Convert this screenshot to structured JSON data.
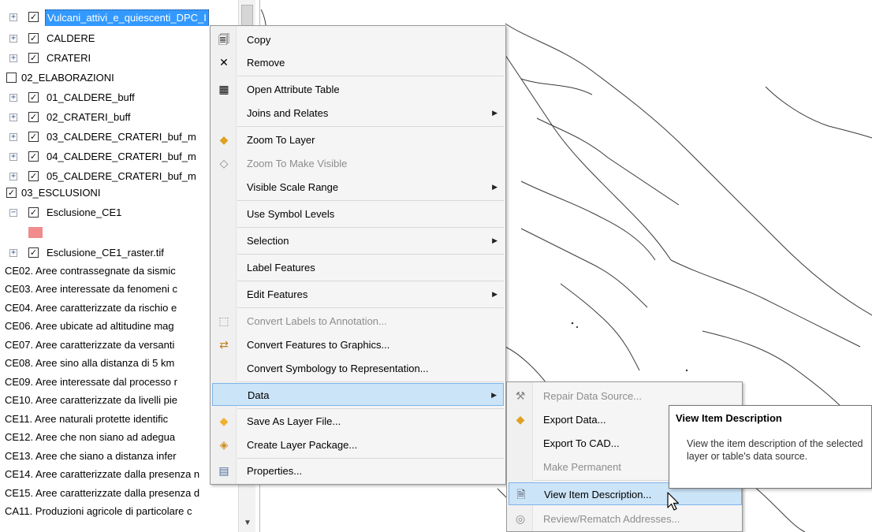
{
  "toc": {
    "layers": [
      {
        "label": "Vulcani_attivi_e_quiescenti_DPC_I",
        "expander": "+",
        "checked": true,
        "selected": true
      },
      {
        "label": "CALDERE",
        "expander": "+",
        "checked": true
      },
      {
        "label": "CRATERI",
        "expander": "+",
        "checked": true
      },
      {
        "label": "02_ELABORAZIONI",
        "checked": false,
        "group": true
      },
      {
        "label": "01_CALDERE_buff",
        "expander": "+",
        "checked": true
      },
      {
        "label": "02_CRATERI_buff",
        "expander": "+",
        "checked": true
      },
      {
        "label": "03_CALDERE_CRATERI_buf_m",
        "expander": "+",
        "checked": true
      },
      {
        "label": "04_CALDERE_CRATERI_buf_m",
        "expander": "+",
        "checked": true
      },
      {
        "label": "05_CALDERE_CRATERI_buf_m",
        "expander": "+",
        "checked": true
      },
      {
        "label": "03_ESCLUSIONI",
        "checked": true,
        "group": true
      },
      {
        "label": "Esclusione_CE1",
        "expander": "−",
        "checked": true
      },
      {
        "label": "Esclusione_CE1_raster.tif",
        "expander": "+",
        "checked": true
      }
    ],
    "swatch_color": "#f08c8c",
    "criteria": [
      "CE02. Aree contrassegnate da sismic",
      "CE03. Aree interessate da fenomeni c",
      "CE04. Aree caratterizzate da rischio e",
      "CE06. Aree ubicate ad altitudine mag",
      "CE07. Aree caratterizzate da versanti",
      "CE08. Aree sino alla distanza di 5 km",
      "CE09. Aree interessate dal processo r",
      "CE10. Aree caratterizzate da livelli pie",
      "CE11. Aree naturali protette identific",
      "CE12. Aree che non siano ad adegua",
      "CE13. Aree che siano a distanza infer",
      "CE14. Aree caratterizzate dalla presenza n",
      "CE15. Aree caratterizzate dalla presenza d",
      "CA11. Produzioni agricole di particolare c"
    ]
  },
  "context_menu": {
    "items": [
      {
        "label": "Copy",
        "icon": "copy-icon",
        "glyph": "🗐"
      },
      {
        "label": "Remove",
        "icon": "remove-icon",
        "glyph": "✕"
      },
      {
        "label": "Open Attribute Table",
        "icon": "table-icon",
        "glyph": "▦"
      },
      {
        "label": "Joins and Relates",
        "submenu": true
      },
      {
        "label": "Zoom To Layer",
        "icon": "zoom-to-layer-icon",
        "glyph": "◆"
      },
      {
        "label": "Zoom To Make Visible",
        "icon": "zoom-visible-icon",
        "glyph": "◇",
        "disabled": true
      },
      {
        "label": "Visible Scale Range",
        "submenu": true
      },
      {
        "label": "Use Symbol Levels"
      },
      {
        "label": "Selection",
        "submenu": true
      },
      {
        "label": "Label Features"
      },
      {
        "label": "Edit Features",
        "submenu": true
      },
      {
        "label": "Convert Labels to Annotation...",
        "icon": "annotation-icon",
        "glyph": "⬚",
        "disabled": true
      },
      {
        "label": "Convert Features to Graphics...",
        "icon": "graphics-icon",
        "glyph": "⇄"
      },
      {
        "label": "Convert Symbology to Representation..."
      },
      {
        "label": "Data",
        "submenu": true,
        "highlighted": true
      },
      {
        "label": "Save As Layer File...",
        "icon": "layer-file-icon",
        "glyph": "◆"
      },
      {
        "label": "Create Layer Package...",
        "icon": "layer-package-icon",
        "glyph": "◈"
      },
      {
        "label": "Properties...",
        "icon": "properties-icon",
        "glyph": "▤"
      }
    ]
  },
  "data_submenu": {
    "items": [
      {
        "label": "Repair Data Source...",
        "icon": "repair-icon",
        "glyph": "⚒",
        "disabled": true
      },
      {
        "label": "Export Data...",
        "icon": "export-data-icon",
        "glyph": "◆"
      },
      {
        "label": "Export To CAD..."
      },
      {
        "label": "Make Permanent",
        "disabled": true
      },
      {
        "label": "View Item Description...",
        "icon": "item-description-icon",
        "glyph": "🗎",
        "highlighted": true
      },
      {
        "label": "Review/Rematch Addresses...",
        "icon": "geocode-icon",
        "glyph": "◎",
        "disabled": true
      }
    ]
  },
  "tooltip": {
    "title": "View Item Description",
    "body": "View the item description of the selected layer or table's data source."
  },
  "colors": {
    "selection": "#3399ff",
    "menu_highlight": "#cce4f7",
    "map_outline": "#3a3a3a"
  }
}
